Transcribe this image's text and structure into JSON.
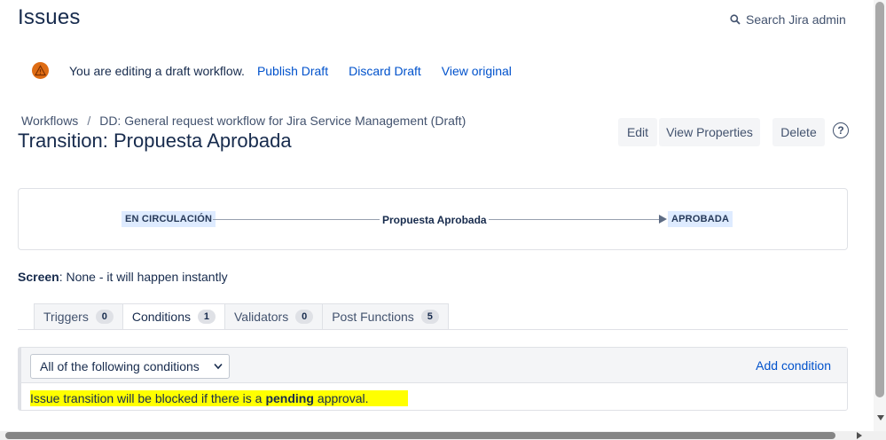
{
  "header": {
    "title": "Issues",
    "search_label": "Search Jira admin"
  },
  "banner": {
    "message": "You are editing a draft workflow.",
    "publish": "Publish Draft",
    "discard": "Discard Draft",
    "view_original": "View original"
  },
  "breadcrumb": {
    "root": "Workflows",
    "separator": "/",
    "workflow": "DD: General request workflow for Jira Service Management (Draft)"
  },
  "title": "Transition: Propuesta Aprobada",
  "actions": {
    "edit": "Edit",
    "view_properties": "View Properties",
    "delete": "Delete",
    "help": "?"
  },
  "diagram": {
    "from_status": "EN CIRCULACIÓN",
    "transition": "Propuesta Aprobada",
    "to_status": "APROBADA"
  },
  "screen": {
    "label": "Screen",
    "value": ": None - it will happen instantly"
  },
  "tabs": [
    {
      "label": "Triggers",
      "count": "0"
    },
    {
      "label": "Conditions",
      "count": "1"
    },
    {
      "label": "Validators",
      "count": "0"
    },
    {
      "label": "Post Functions",
      "count": "5"
    }
  ],
  "conditions": {
    "mode": "All of the following conditions",
    "add": "Add condition",
    "rule_before": "Issue transition will be blocked if there is a",
    "rule_bold": "pending",
    "rule_after": "approval."
  },
  "colors": {
    "accent": "#0052cc",
    "warning": "#de6c14",
    "highlight": "#ffff00",
    "status_bg": "#deebff"
  },
  "icons": {
    "search": "search-icon",
    "warning": "warning-icon",
    "help": "help-icon",
    "chevron": "chevron-down-icon"
  }
}
